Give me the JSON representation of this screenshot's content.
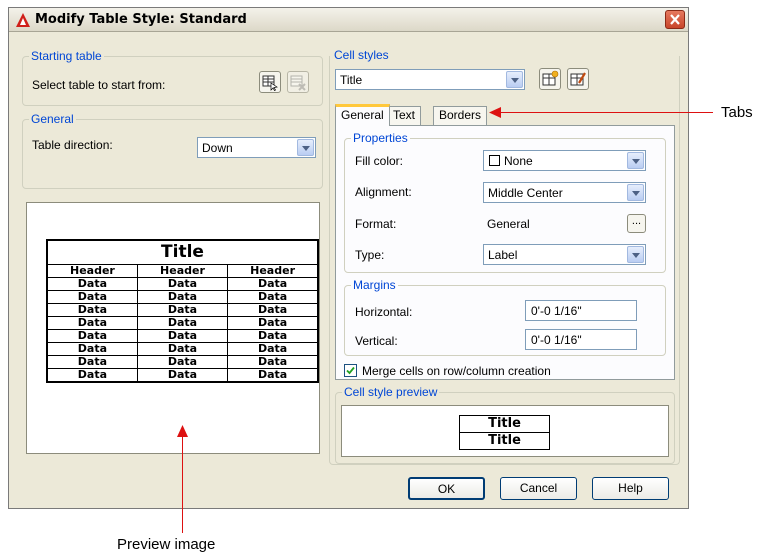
{
  "window": {
    "title": "Modify Table Style: Standard"
  },
  "starting_table": {
    "legend": "Starting table",
    "prompt": "Select table to start from:"
  },
  "general": {
    "legend": "General",
    "direction_label": "Table direction:",
    "direction_value": "Down"
  },
  "preview_table": {
    "title": "Title",
    "headers": [
      "Header",
      "Header",
      "Header"
    ],
    "rows": [
      [
        "Data",
        "Data",
        "Data"
      ],
      [
        "Data",
        "Data",
        "Data"
      ],
      [
        "Data",
        "Data",
        "Data"
      ],
      [
        "Data",
        "Data",
        "Data"
      ],
      [
        "Data",
        "Data",
        "Data"
      ],
      [
        "Data",
        "Data",
        "Data"
      ],
      [
        "Data",
        "Data",
        "Data"
      ],
      [
        "Data",
        "Data",
        "Data"
      ]
    ]
  },
  "cell_styles": {
    "legend": "Cell styles",
    "selected": "Title"
  },
  "tabs": [
    "General",
    "Text",
    "Borders"
  ],
  "properties": {
    "legend": "Properties",
    "fill_color_label": "Fill color:",
    "fill_color_value": "None",
    "alignment_label": "Alignment:",
    "alignment_value": "Middle Center",
    "format_label": "Format:",
    "format_value": "General",
    "format_button": "...",
    "type_label": "Type:",
    "type_value": "Label"
  },
  "margins": {
    "legend": "Margins",
    "horizontal_label": "Horizontal:",
    "horizontal_value": "0'-0 1/16\"",
    "vertical_label": "Vertical:",
    "vertical_value": "0'-0 1/16\""
  },
  "merge_label": "Merge cells on row/column creation",
  "merge_checked": true,
  "cell_style_preview": {
    "legend": "Cell style preview",
    "rows": [
      "Title",
      "Title"
    ]
  },
  "buttons": {
    "ok": "OK",
    "cancel": "Cancel",
    "help": "Help"
  },
  "callouts": {
    "tabs": "Tabs",
    "preview": "Preview image"
  },
  "colors": {
    "callout_line": "#dd1111",
    "legend_text": "#0046d5",
    "dialog_bg": "#ece9d8"
  }
}
